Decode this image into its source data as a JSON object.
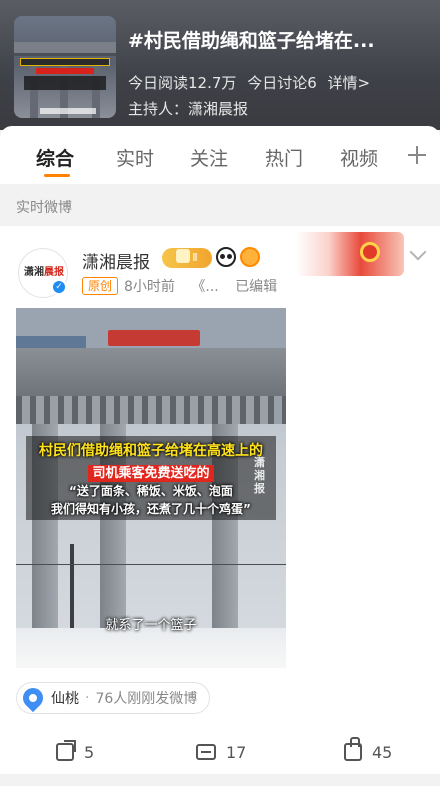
{
  "topic": {
    "title": "#村民借助绳和篮子给堵在...",
    "reads": "今日阅读12.7万",
    "discussions": "今日讨论6",
    "details": "详情>",
    "host": "主持人：潇湘晨报"
  },
  "tabs": [
    {
      "label": "综合",
      "active": true
    },
    {
      "label": "实时",
      "active": false
    },
    {
      "label": "关注",
      "active": false
    },
    {
      "label": "热门",
      "active": false
    },
    {
      "label": "视频",
      "active": false
    }
  ],
  "section_label": "实时微博",
  "post": {
    "author": "潇湘晨报",
    "avatar_text_a": "潇湘",
    "avatar_text_b": "晨报",
    "badge_text": "Ⅱ",
    "original_tag": "原创",
    "time": "8小时前",
    "source": "《...",
    "edited": "已编辑",
    "video": {
      "caption_line1": "村民们借助绳和篮子给堵在高速上的",
      "caption_line2": "司机乘客免费送吃的",
      "caption_line3": "“送了面条、稀饭、米饭、泡面",
      "caption_line4": "我们得知有小孩，还煮了几十个鸡蛋”",
      "watermark": "潇湘报",
      "subtitle": "就系了一个篮子"
    },
    "location": {
      "name": "仙桃",
      "dot": "·",
      "info": "76人刚刚发微博"
    },
    "actions": {
      "reposts": "5",
      "comments": "17",
      "likes": "45"
    }
  },
  "colors": {
    "accent": "#ff8200",
    "verified": "#1e8cf0",
    "location_pin": "#3f8ef3"
  },
  "icons": [
    "chevron-down-icon",
    "plus-icon",
    "verified-icon",
    "panda-icon",
    "bird-icon",
    "pin-icon",
    "share-icon",
    "comment-icon",
    "like-icon"
  ]
}
